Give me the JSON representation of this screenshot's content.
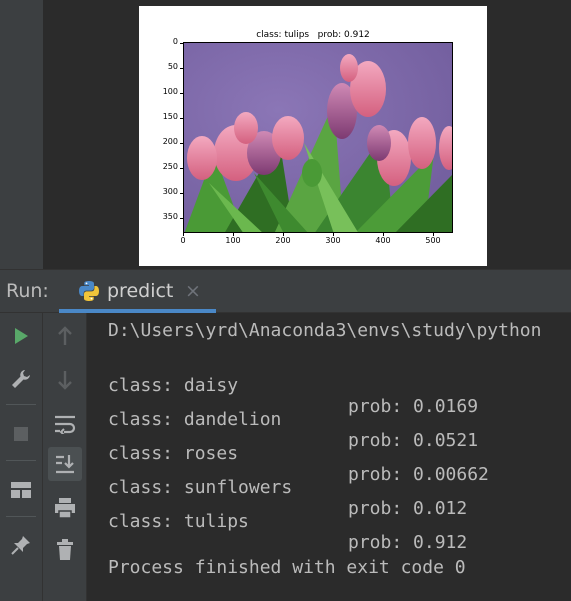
{
  "plot": {
    "title": "class: tulips   prob: 0.912",
    "yticks": [
      "0",
      "50",
      "100",
      "150",
      "200",
      "250",
      "300",
      "350"
    ],
    "xticks": [
      "0",
      "100",
      "200",
      "300",
      "400",
      "500"
    ]
  },
  "run_panel": {
    "label": "Run:",
    "tab_label": "predict",
    "tab_close": "×"
  },
  "console": {
    "path_line": "D:\\Users\\yrd\\Anaconda3\\envs\\study\\python",
    "results": [
      {
        "cls": "class: daisy",
        "prob": "prob: 0.0169"
      },
      {
        "cls": "class: dandelion",
        "prob": "prob: 0.0521"
      },
      {
        "cls": "class: roses",
        "prob": "prob: 0.00662"
      },
      {
        "cls": "class: sunflowers",
        "prob": "prob: 0.012"
      },
      {
        "cls": "class: tulips",
        "prob": "prob: 0.912"
      }
    ],
    "exit_line": "Process finished with exit code 0"
  },
  "colors": {
    "run_green": "#59a869",
    "tab_underline": "#4a88c7"
  },
  "icons": [
    "play-icon",
    "wrench-icon",
    "stop-icon",
    "layout-icon",
    "pin-icon",
    "up-arrow-icon",
    "down-arrow-icon",
    "soft-wrap-icon",
    "scroll-to-end-icon",
    "print-icon",
    "trash-icon",
    "python-icon"
  ]
}
